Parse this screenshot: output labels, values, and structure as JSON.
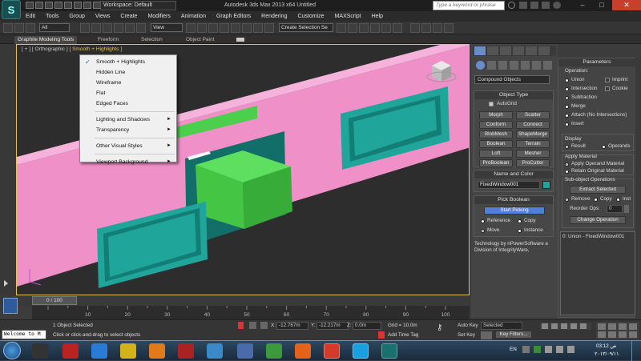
{
  "window": {
    "workspace": "Workspace: Default",
    "title": "Autodesk 3ds Max  2013 x64     Untitled",
    "search_placeholder": "Type a keyword or phrase"
  },
  "menubar": [
    "Edit",
    "Tools",
    "Group",
    "Views",
    "Create",
    "Modifiers",
    "Animation",
    "Graph Editors",
    "Rendering",
    "Customize",
    "MAXScript",
    "Help"
  ],
  "toolbar": {
    "selection_filter": "All",
    "reference_coord": "View",
    "named_selection": "Create Selection Se"
  },
  "ribbon": {
    "tabs": [
      "Graphite Modeling Tools",
      "Freeform",
      "Selection",
      "Object Paint"
    ]
  },
  "viewport": {
    "label_plus": "[ + ]",
    "label_view": "[ Orthographic ]",
    "label_shading": "[ Smooth + Highlights ]"
  },
  "context_menu": {
    "items": [
      {
        "label": "Smooth + Highlights",
        "checked": true,
        "submenu": false
      },
      {
        "label": "Hidden Line",
        "checked": false,
        "submenu": false
      },
      {
        "label": "Wireframe",
        "checked": false,
        "submenu": false
      },
      {
        "label": "Flat",
        "checked": false,
        "submenu": false
      },
      {
        "label": "Edged Faces",
        "checked": false,
        "submenu": false
      },
      {
        "label": "Lighting and Shadows",
        "checked": false,
        "submenu": true
      },
      {
        "label": "Transparency",
        "checked": false,
        "submenu": true
      },
      {
        "label": "Other Visual Styles",
        "checked": false,
        "submenu": true
      },
      {
        "label": "Viewport Background",
        "checked": false,
        "submenu": true
      }
    ],
    "check_mark": "✓",
    "submenu_arrow": "►"
  },
  "command_panel": {
    "category": "Compound Objects",
    "object_type": {
      "title": "Object Type",
      "autogrid": "AutoGrid",
      "buttons": [
        "Morph",
        "Scatter",
        "Conform",
        "Connect",
        "BlobMesh",
        "ShapeMerge",
        "Boolean",
        "Terrain",
        "Loft",
        "Mesher",
        "ProBoolean",
        "ProCutter"
      ]
    },
    "name_and_color": {
      "title": "Name and Color",
      "name": "FixedWindow001",
      "color": "#1fa59a"
    },
    "pick_boolean": {
      "title": "Pick Boolean",
      "start_picking": "Start Picking",
      "options": [
        "Reference",
        "Copy",
        "Move",
        "Instance"
      ],
      "selected": "Move"
    },
    "credits": "Technology by nPowerSoftware a Division of IntegrityWare,"
  },
  "parameters": {
    "title": "Parameters",
    "operation_label": "Operation:",
    "operations": [
      "Union",
      "Intersection",
      "Subtraction",
      "Merge",
      "Attach (No Intersections)",
      "Insert"
    ],
    "selected_operation": "Subtraction",
    "imprint": "Imprint",
    "cookie": "Cookie",
    "display_label": "Display",
    "display_result": "Result",
    "display_operands": "Operands",
    "apply_material_label": "Apply Material",
    "apply_operand_material": "Apply Operand Material",
    "retain_original_material": "Retain Original Material",
    "subobject_label": "Sub-object Operations",
    "extract_selected": "Extract Selected",
    "remove": "Remove",
    "copy": "Copy",
    "inst": "Inst",
    "reorder_label": "Reorder Ops:",
    "reorder_value": "0",
    "change_operation": "Change Operation",
    "operand_list_item": "0: Union - FixedWindow001"
  },
  "timeline": {
    "frame_display": "0 / 100",
    "ticks": [
      "10",
      "20",
      "30",
      "40",
      "50",
      "60",
      "70",
      "80",
      "90",
      "100"
    ]
  },
  "status": {
    "maxscript_listener": "Welcome to M",
    "selection_count": "1 Object Selected",
    "prompt": "Click or click-and-drag to select objects",
    "x_label": "X:",
    "x_value": "-12.767m",
    "y_label": "Y:",
    "y_value": "-12.217m",
    "z_label": "Z:",
    "z_value": "0.0m",
    "grid": "Grid = 10.0m",
    "add_time_tag": "Add Time Tag",
    "auto_key": "Auto Key",
    "set_key": "Set Key",
    "key_mode": "Selected",
    "key_filters": "Key Filters..."
  },
  "taskbar": {
    "language": "EN",
    "time": "03:12 ص",
    "date": "۲۰۱۳/۰۹/۱۱"
  },
  "colors": {
    "wall": "#f090c8",
    "window_frame": "#1fa59a",
    "green_box": "#4ccf4c",
    "viewport_border": "#e3c25a",
    "highlight_button": "#4f7fd6"
  }
}
